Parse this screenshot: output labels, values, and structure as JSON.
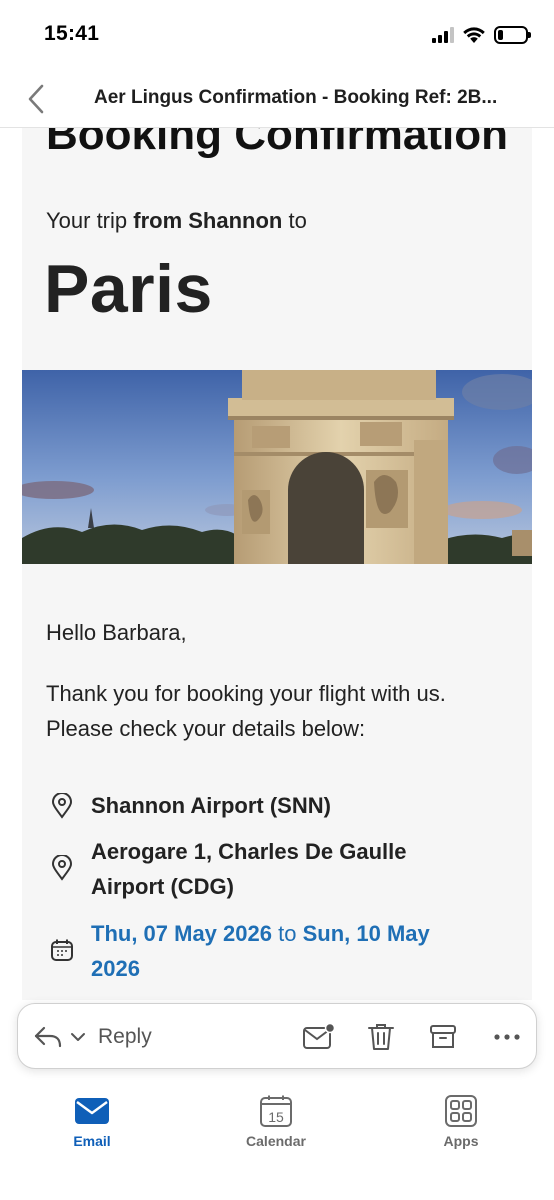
{
  "status_bar": {
    "time": "15:41",
    "battery_level": 0.2,
    "icons": [
      "cellular-signal-icon",
      "wifi-icon",
      "battery-icon"
    ]
  },
  "header": {
    "title": "Aer Lingus Confirmation - Booking Ref: 2B..."
  },
  "email": {
    "heading": "Booking Confirmation",
    "trip_prefix": "Your trip",
    "trip_from": "from Shannon",
    "trip_suffix": "to",
    "destination": "Paris",
    "greeting": "Hello Barbara,",
    "thanks_line1": "Thank you for booking your flight with us.",
    "thanks_line2": "Please check your details below:",
    "origin_airport": "Shannon Airport (SNN)",
    "dest_airport_line1": "Aerogare 1, Charles De Gaulle",
    "dest_airport_line2": "Airport (CDG)",
    "date_start": "Thu, 07 May 2026",
    "date_to": "to",
    "date_end_line1": "Sun, 10 May",
    "date_end_line2": "2026"
  },
  "action_bar": {
    "reply_label": "Reply",
    "icons": [
      "reply-icon",
      "chevron-down-icon",
      "mark-unread-icon",
      "trash-icon",
      "archive-icon",
      "more-icon"
    ]
  },
  "tabs": [
    {
      "label": "Email",
      "icon": "email-icon",
      "active": true
    },
    {
      "label": "Calendar",
      "icon": "calendar-icon",
      "day": "15",
      "active": false
    },
    {
      "label": "Apps",
      "icon": "apps-icon",
      "active": false
    }
  ],
  "colors": {
    "accent": "#0f5fb8",
    "link_blue": "#1f6fb5",
    "email_background": "#f6f6f6"
  }
}
